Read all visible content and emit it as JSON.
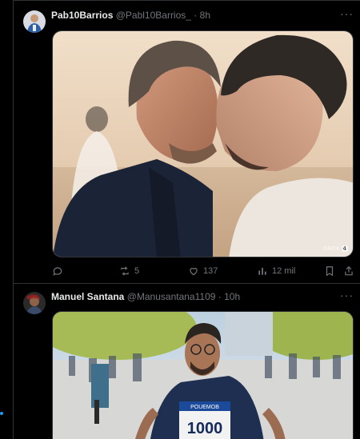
{
  "posts": [
    {
      "name": "Pab10Barrios",
      "handle": "@Pabl10Barrios_",
      "separator": "·",
      "time": "8h",
      "more": "···",
      "media_caption": "GROK",
      "media_badge": "4",
      "actions": {
        "reply_count": "",
        "repost_count": "5",
        "like_count": "137",
        "views_count": "12 mil"
      }
    },
    {
      "name": "Manuel Santana",
      "handle": "@Manusantana1109",
      "separator": "·",
      "time": "10h",
      "more": "···",
      "bib_brand": "POUEMOB",
      "bib_number": "1000"
    }
  ],
  "icons": [
    "reply-icon",
    "repost-icon",
    "like-icon",
    "views-icon",
    "bookmark-icon",
    "share-icon",
    "more-icon"
  ],
  "colors": {
    "background": "#000000",
    "text": "#e7e9ea",
    "muted": "#71767b",
    "border": "#2f3336",
    "accent": "#1d9bf0"
  }
}
